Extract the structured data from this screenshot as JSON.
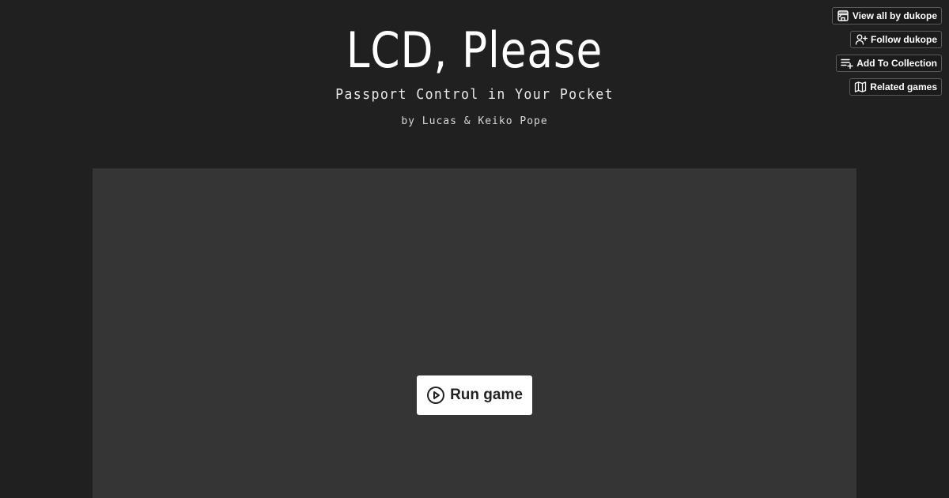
{
  "header": {
    "title": "LCD, Please",
    "tagline": "Passport Control in Your Pocket",
    "byline": "by Lucas & Keiko Pope"
  },
  "user_tools": [
    {
      "label": "View all by dukope",
      "icon": "storefront-icon"
    },
    {
      "label": "Follow dukope",
      "icon": "user-plus-icon"
    },
    {
      "label": "Add To Collection",
      "icon": "playlist-add-icon"
    },
    {
      "label": "Related games",
      "icon": "map-icon"
    }
  ],
  "game_frame": {
    "run_label": "Run game",
    "run_icon": "play-circle-icon"
  },
  "colors": {
    "page_background": "#202020",
    "frame_background": "#353535",
    "button_background": "#ffffff",
    "button_text": "#222222"
  }
}
